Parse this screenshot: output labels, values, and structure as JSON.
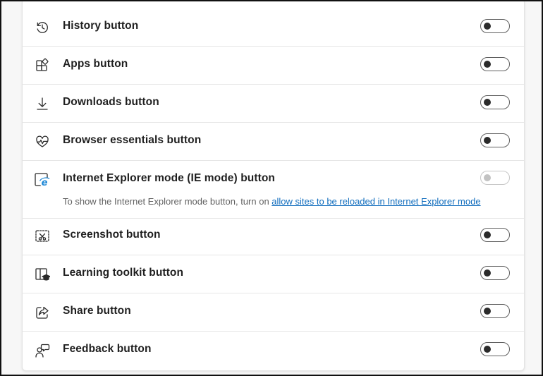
{
  "settings": [
    {
      "label": "History button",
      "icon": "history-icon",
      "state": "off"
    },
    {
      "label": "Apps button",
      "icon": "apps-icon",
      "state": "off"
    },
    {
      "label": "Downloads button",
      "icon": "download-icon",
      "state": "off"
    },
    {
      "label": "Browser essentials button",
      "icon": "heart-pulse-icon",
      "state": "off"
    },
    {
      "label": "Internet Explorer mode (IE mode) button",
      "icon": "internet-explorer-icon",
      "state": "off-disabled",
      "description": "To show the Internet Explorer mode button, turn on ",
      "link": "allow sites to be reloaded in Internet Explorer mode"
    },
    {
      "label": "Screenshot button",
      "icon": "screenshot-icon",
      "state": "off"
    },
    {
      "label": "Learning toolkit button",
      "icon": "learning-toolkit-icon",
      "state": "off"
    },
    {
      "label": "Share button",
      "icon": "share-icon",
      "state": "off"
    },
    {
      "label": "Feedback button",
      "icon": "feedback-icon",
      "state": "off"
    }
  ],
  "colors": {
    "link": "#0f6cbd",
    "ie_logo": "#1e88d6",
    "text": "#1f1f1f",
    "subtext": "#616161"
  }
}
